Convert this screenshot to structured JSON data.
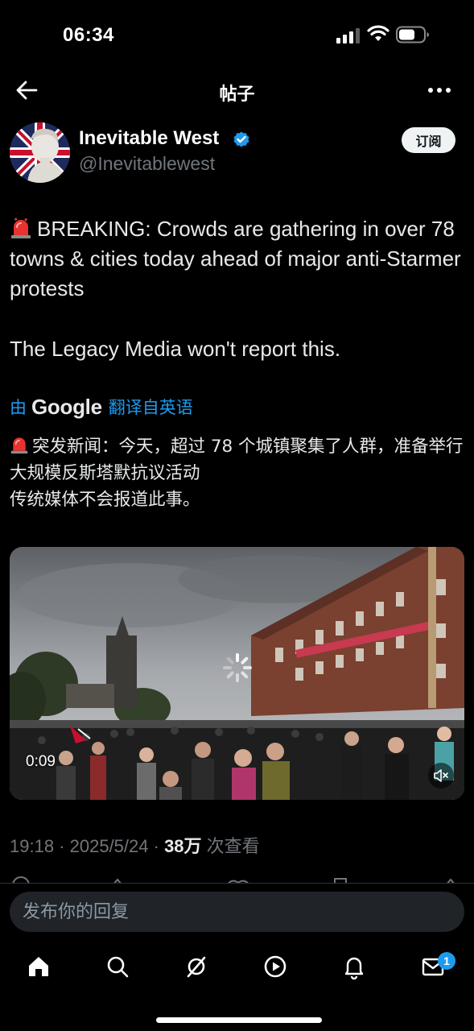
{
  "status_bar": {
    "time": "06:34",
    "icons": [
      "cellular-signal-icon",
      "wifi-icon",
      "battery-icon"
    ]
  },
  "header": {
    "title": "帖子",
    "back_icon": "back-arrow-icon",
    "more_icon": "more-options-icon"
  },
  "author": {
    "display_name": "Inevitable West",
    "handle": "@Inevitablewest",
    "verified": true,
    "subscribe_label": "订阅"
  },
  "tweet": {
    "line_1": "BREAKING: Crowds are gathering in over 78 towns & cities today ahead of major anti-Starmer protests",
    "line_2": "The Legacy Media won't report this."
  },
  "translation": {
    "by_label": "由",
    "provider": "Google",
    "from_label": "翻译自英语",
    "line_1": "突发新闻：今天，超过 78 个城镇聚集了人群，准备举行大规模反斯塔默抗议活动",
    "line_2": "传统媒体不会报道此事。"
  },
  "video": {
    "elapsed": "0:09",
    "muted": true
  },
  "meta": {
    "time": "19:18",
    "date": "2025/5/24",
    "views_count": "38万",
    "views_label": "次查看"
  },
  "reply": {
    "placeholder": "发布你的回复"
  },
  "tabbar": {
    "items": [
      "home-icon",
      "search-icon",
      "grok-icon",
      "video-icon",
      "notifications-icon",
      "messages-icon"
    ],
    "messages_badge": "1"
  },
  "colors": {
    "background": "#000000",
    "accent": "#1d9bf0",
    "text": "#e7e9ea",
    "muted_text": "#71767b"
  }
}
